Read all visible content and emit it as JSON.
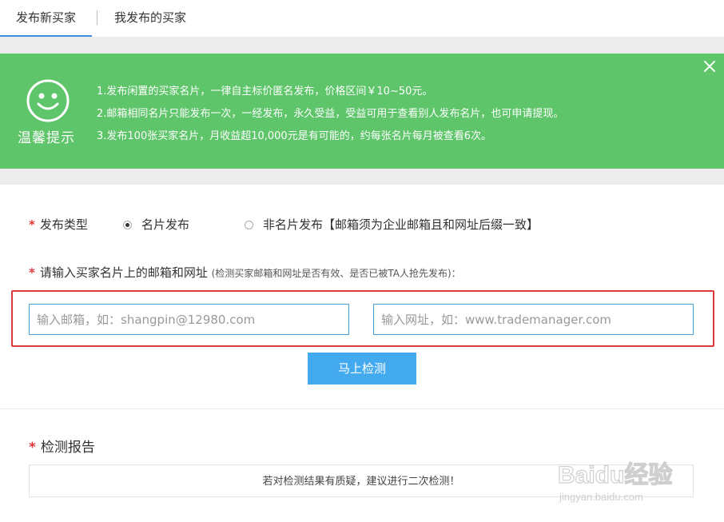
{
  "tabs": [
    {
      "label": "发布新买家",
      "active": true
    },
    {
      "label": "我发布的买家",
      "active": false
    }
  ],
  "tip": {
    "caption": "温馨提示",
    "lines": [
      "1.发布闲置的买家名片，一律自主标价匿名发布，价格区间￥10~50元。",
      "2.邮箱相同名片只能发布一次，一经发布，永久受益，受益可用于查看别人发布名片，也可申请提现。",
      "3.发布100张买家名片，月收益超10,000元是有可能的，约每张名片每月被查看6次。"
    ],
    "color": "#5ec56a"
  },
  "form": {
    "required_mark": "*",
    "type_label": "发布类型",
    "options": [
      {
        "label": "名片发布",
        "checked": true
      },
      {
        "label": "非名片发布【邮箱须为企业邮箱且和网址后缀一致】",
        "checked": false
      }
    ],
    "input_label": "请输入买家名片上的邮箱和网址",
    "input_hint": "(检测买家邮箱和网址是否有效、是否已被TA人抢先发布)：",
    "email_placeholder": "输入邮箱，如：shangpin@12980.com",
    "url_placeholder": "输入网址，如：www.trademanager.com",
    "check_button": "马上检测"
  },
  "report": {
    "title": "检测报告",
    "message": "若对检测结果有质疑，建议进行二次检测！"
  },
  "watermark": {
    "brand": "Baidu经验",
    "url": "jingyan.baidu.com"
  },
  "colors": {
    "accent": "#43aaf0",
    "tab_underline": "#3d8fe0",
    "highlight": "#d9393a",
    "required": "#e4393c"
  }
}
